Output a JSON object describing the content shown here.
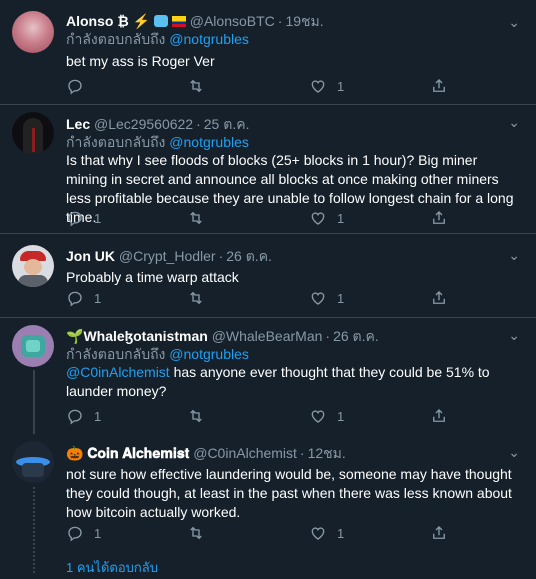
{
  "more_label": "⌄",
  "tweets": [
    {
      "name": "Alonso ₿",
      "name_emoji": "⚡",
      "handle": "@AlonsoBTC",
      "time": "19ชม.",
      "replying_prefix": "กำลังตอบกลับถึง",
      "replying_to": "@notgrubles",
      "text": "bet my ass is Roger Ver",
      "reply_count": "",
      "like_count": "1"
    },
    {
      "name": "Lec",
      "handle": "@Lec29560622",
      "time": "25 ต.ค.",
      "replying_prefix": "กำลังตอบกลับถึง",
      "replying_to": "@notgrubles",
      "text": "Is that why I see floods of blocks (25+ blocks in 1 hour)? Big miner mining in secret and announce all blocks at once making other miners less profitable because they are unable to follow longest chain for a long time.",
      "reply_count": "1",
      "like_count": "1"
    },
    {
      "name": "Jon UK",
      "handle": "@Crypt_Hodler",
      "time": "26 ต.ค.",
      "text": "Probably a time warp attack",
      "reply_count": "1",
      "like_count": "1"
    },
    {
      "name_emoji": "🌱",
      "name": "Whaleɮotanistman",
      "handle": "@WhaleBearMan",
      "time": "26 ต.ค.",
      "replying_prefix": "กำลังตอบกลับถึง",
      "replying_to": "@notgrubles",
      "mention": "@C0inAlchemist",
      "text": " has anyone ever thought that they could be 51% to launder money?",
      "reply_count": "1",
      "like_count": "1"
    },
    {
      "name_emoji": "🎃",
      "name": "𝐂𝐨𝐢𝐧 𝐀𝐥𝐜𝐡𝐞𝐦𝐢𝐬𝐭",
      "handle": "@C0inAlchemist",
      "time": "12ชม.",
      "text": "not sure how effective laundering would be, someone may have thought they could though, at least in the past when there was less known about how bitcoin actually worked.",
      "reply_count": "1",
      "like_count": "1"
    }
  ],
  "show_replies": "1 คนได้ตอบกลับ",
  "colors": {
    "background": "#15202b",
    "link": "#1da1f2",
    "muted": "#8899a6",
    "divider": "#38444d"
  }
}
